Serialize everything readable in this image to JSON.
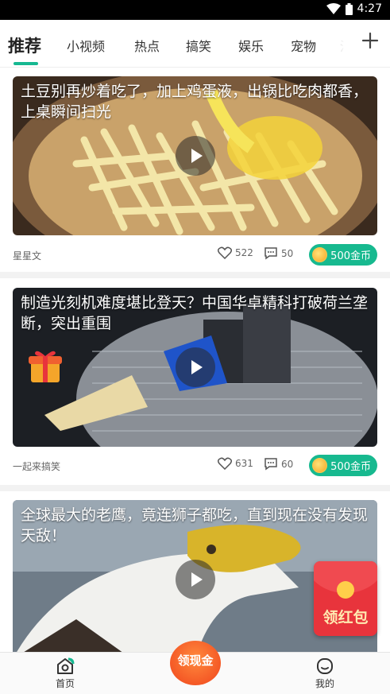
{
  "status_bar": {
    "time": "4:27"
  },
  "tabs": {
    "items": [
      {
        "label": "推荐",
        "active": true
      },
      {
        "label": "小视频"
      },
      {
        "label": "热点"
      },
      {
        "label": "搞笑"
      },
      {
        "label": "娱乐"
      },
      {
        "label": "宠物"
      },
      {
        "label": "汽"
      }
    ]
  },
  "feed": [
    {
      "title": "土豆别再炒着吃了，加上鸡蛋液，出锅比吃肉都香，上桌瞬间扫光",
      "author": "星星文",
      "likes": "522",
      "comments": "50",
      "reward": "500金币"
    },
    {
      "title": "制造光刻机难度堪比登天？中国华卓精科打破荷兰垄断，突出重围",
      "author": "一起来搞笑",
      "likes": "631",
      "comments": "60",
      "reward": "500金币"
    },
    {
      "title": "全球最大的老鹰，竟连狮子都吃，直到现在没有发现天敌！"
    }
  ],
  "red_packet": {
    "label": "领红包"
  },
  "bottom_nav": {
    "home": "首页",
    "cash": "领现金",
    "mine": "我的"
  },
  "colors": {
    "accent": "#16b891",
    "coin_button": "#17b98f",
    "red_packet": "#e8343c",
    "cash_button": "#f0441c"
  }
}
